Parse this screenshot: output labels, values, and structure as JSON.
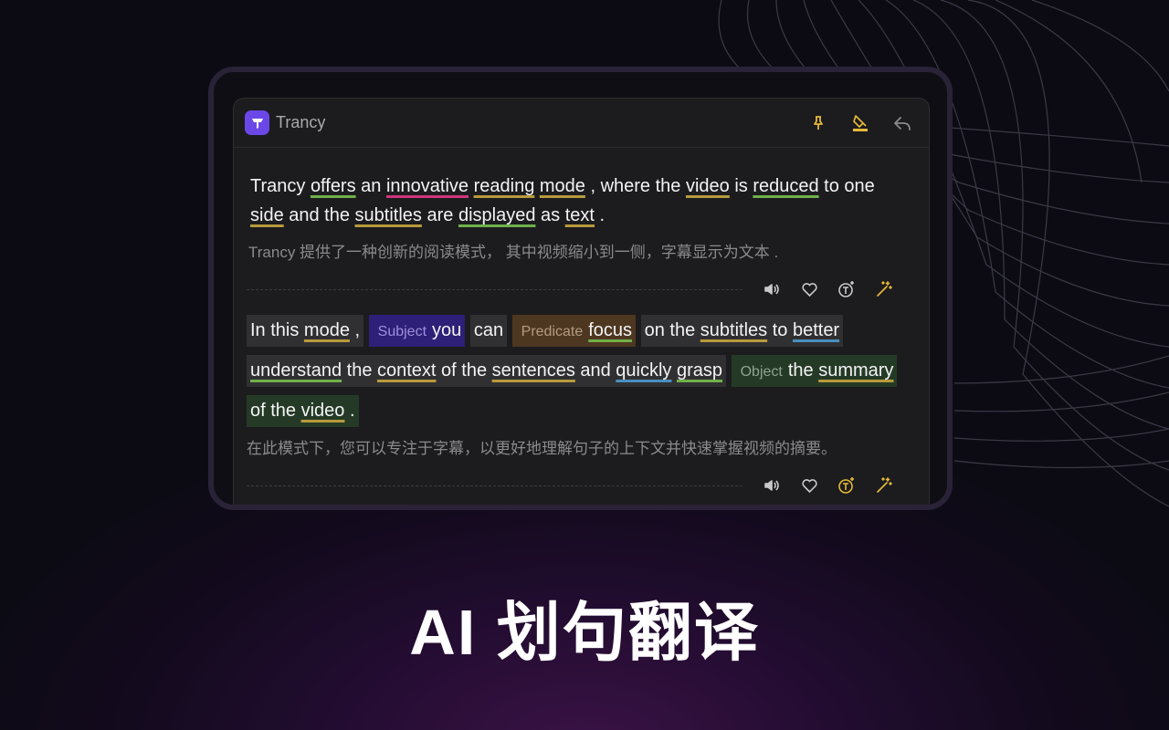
{
  "app": {
    "title": "Trancy"
  },
  "colors": {
    "accent": "#e6b93a",
    "brand": "#6b47e8"
  },
  "header": {
    "icons": [
      "pin-icon",
      "highlight-icon",
      "reply-icon"
    ]
  },
  "sentence1": {
    "original": [
      {
        "t": "Trancy ",
        "u": ""
      },
      {
        "t": "offers",
        "u": "green"
      },
      {
        "t": " an ",
        "u": ""
      },
      {
        "t": "innovative",
        "u": "pink"
      },
      {
        "t": " ",
        "u": ""
      },
      {
        "t": "reading",
        "u": "gold"
      },
      {
        "t": " ",
        "u": ""
      },
      {
        "t": "mode",
        "u": "gold"
      },
      {
        "t": " , where the ",
        "u": ""
      },
      {
        "t": "video",
        "u": "gold"
      },
      {
        "t": " is ",
        "u": ""
      },
      {
        "t": "reduced",
        "u": "green"
      },
      {
        "t": " to one ",
        "u": ""
      },
      {
        "t": "side",
        "u": "gold"
      },
      {
        "t": " and the ",
        "u": ""
      },
      {
        "t": "subtitles",
        "u": "gold"
      },
      {
        "t": " are ",
        "u": ""
      },
      {
        "t": "displayed",
        "u": "green"
      },
      {
        "t": " as ",
        "u": ""
      },
      {
        "t": "text",
        "u": "gold"
      },
      {
        "t": " .",
        "u": ""
      }
    ],
    "translation": "Trancy 提供了一种创新的阅读模式， 其中视频缩小到一侧，字幕显示为文本 ."
  },
  "sentence2": {
    "segments": [
      {
        "bg": "gray",
        "tag": "",
        "words": [
          {
            "t": "In this ",
            "u": ""
          },
          {
            "t": "mode",
            "u": "gold"
          },
          {
            "t": " ,",
            "u": ""
          }
        ]
      },
      {
        "bg": "purple",
        "tag": "Subject",
        "words": [
          {
            "t": "you",
            "u": ""
          }
        ]
      },
      {
        "bg": "gray",
        "tag": "",
        "words": [
          {
            "t": "can",
            "u": ""
          }
        ]
      },
      {
        "bg": "brown",
        "tag": "Predicate",
        "words": [
          {
            "t": "focus",
            "u": "green"
          }
        ]
      },
      {
        "bg": "gray",
        "tag": "",
        "words": [
          {
            "t": "on the ",
            "u": ""
          },
          {
            "t": "subtitles",
            "u": "gold"
          },
          {
            "t": " to ",
            "u": ""
          },
          {
            "t": "better",
            "u": "blue"
          },
          {
            "t": " ",
            "u": ""
          },
          {
            "t": "understand",
            "u": "green"
          },
          {
            "t": " the ",
            "u": ""
          },
          {
            "t": "context",
            "u": "gold"
          },
          {
            "t": " of the ",
            "u": ""
          },
          {
            "t": "sentences",
            "u": "gold"
          },
          {
            "t": " and ",
            "u": ""
          },
          {
            "t": "quickly",
            "u": "blue"
          },
          {
            "t": " ",
            "u": ""
          },
          {
            "t": "grasp",
            "u": "green"
          }
        ]
      },
      {
        "bg": "green",
        "tag": "Object",
        "words": [
          {
            "t": "the ",
            "u": ""
          },
          {
            "t": "summary",
            "u": "gold"
          },
          {
            "t": " of the ",
            "u": ""
          },
          {
            "t": "video",
            "u": "gold"
          },
          {
            "t": " .",
            "u": ""
          }
        ]
      }
    ],
    "translation": "在此模式下，您可以专注于字幕，以更好地理解句子的上下文并快速掌握视频的摘要。"
  },
  "tools": [
    "speaker-icon",
    "heart-icon",
    "translate-icon",
    "magic-wand-icon"
  ],
  "headline": "AI 划句翻译"
}
